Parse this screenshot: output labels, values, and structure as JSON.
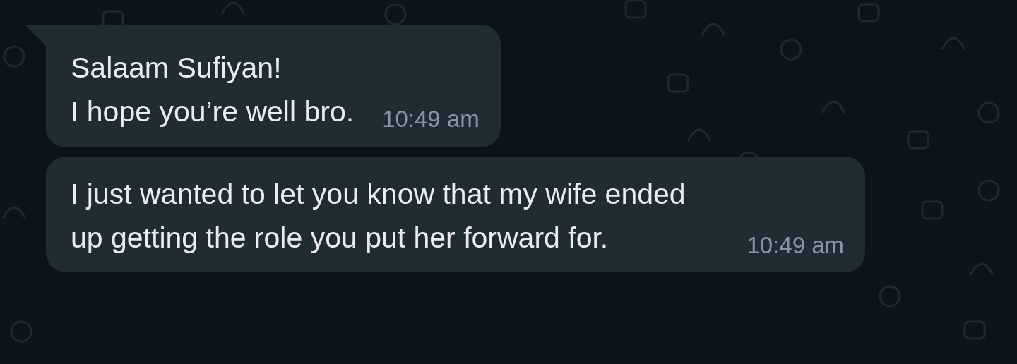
{
  "messages": [
    {
      "tail": true,
      "text": "Salaam Sufiyan!\nI hope you’re well bro.",
      "time": "10:49 am"
    },
    {
      "tail": false,
      "text": "I just wanted to let you know that my wife ended up getting the role you put her forward for.",
      "time": "10:49 am"
    }
  ]
}
